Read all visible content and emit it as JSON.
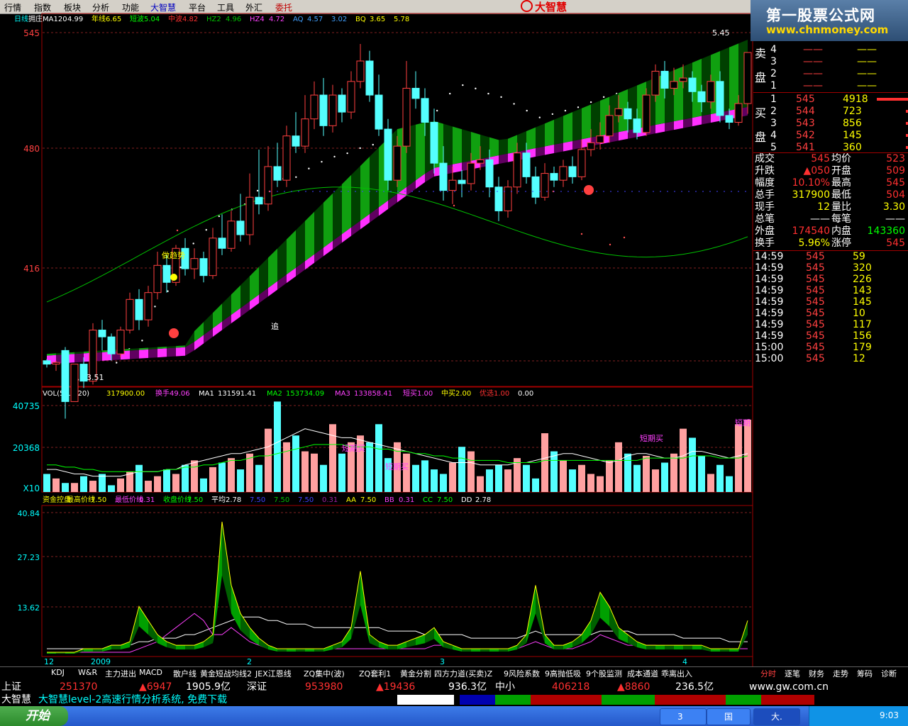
{
  "menu": [
    "行情",
    "指数",
    "板块",
    "分析",
    "功能",
    "大智慧",
    "平台",
    "工具",
    "外汇",
    "委托"
  ],
  "logo": "大智慧",
  "watermark": {
    "line1": "第一股票公式网",
    "line2": "www.chnmoney.com"
  },
  "main_legend": [
    {
      "t": "日线",
      "c": "#00ffff"
    },
    {
      "t": "拥庄MA120",
      "c": "#ffffff"
    },
    {
      "t": "4.99",
      "c": "#ffffff"
    },
    {
      "t": "年线",
      "c": "#ffff00"
    },
    {
      "t": "6.65",
      "c": "#ffff00"
    },
    {
      "t": "短波",
      "c": "#00ff00"
    },
    {
      "t": "5.04",
      "c": "#00ff00"
    },
    {
      "t": "中波",
      "c": "#ff3030"
    },
    {
      "t": "4.82",
      "c": "#ff3030"
    },
    {
      "t": "HZ2",
      "c": "#00c000"
    },
    {
      "t": "4.96",
      "c": "#00c000"
    },
    {
      "t": "HZ4",
      "c": "#ff40ff"
    },
    {
      "t": "4.72",
      "c": "#ff40ff"
    },
    {
      "t": "AQ",
      "c": "#40a0ff"
    },
    {
      "t": "4.57",
      "c": "#40a0ff"
    },
    {
      "t": "3.02",
      "c": "#40a0ff"
    },
    {
      "t": "BQ",
      "c": "#ffff00"
    },
    {
      "t": "3.65",
      "c": "#ffff00"
    },
    {
      "t": "5.78",
      "c": "#ffff00"
    }
  ],
  "y_axis_main": [
    "545",
    "480",
    "416"
  ],
  "price_annot": {
    "high": "5.45",
    "low": "3.51",
    "tag1": "做趋势",
    "tag2": "追"
  },
  "vol_legend": [
    {
      "t": "VOL(5,10,20)",
      "c": "#ffffff"
    },
    {
      "t": "317900.00",
      "c": "#ffff00"
    },
    {
      "t": "换手",
      "c": "#ff40ff"
    },
    {
      "t": "49.06",
      "c": "#ff40ff"
    },
    {
      "t": "MA1",
      "c": "#ffffff"
    },
    {
      "t": "131591.41",
      "c": "#ffffff"
    },
    {
      "t": "MA2",
      "c": "#00ff00"
    },
    {
      "t": "153734.09",
      "c": "#00ff00"
    },
    {
      "t": "MA3",
      "c": "#ff40ff"
    },
    {
      "t": "133858.41",
      "c": "#ff40ff"
    },
    {
      "t": "短买",
      "c": "#ff40ff"
    },
    {
      "t": "1.00",
      "c": "#ff40ff"
    },
    {
      "t": "中买",
      "c": "#ffff00"
    },
    {
      "t": "2.00",
      "c": "#ffff00"
    },
    {
      "t": "优选",
      "c": "#ff3030"
    },
    {
      "t": "1.00",
      "c": "#ff3030"
    },
    {
      "t": "0.00",
      "c": "#ffffff"
    }
  ],
  "y_axis_vol": [
    "40735",
    "20368",
    "X10"
  ],
  "vol_annot": [
    "短期买",
    "短期买",
    "短期买",
    "短期"
  ],
  "ctrl_legend": [
    {
      "t": "资金控盘",
      "c": "#ffff00"
    },
    {
      "t": "最高价线",
      "c": "#ffff00"
    },
    {
      "t": "7.50",
      "c": "#ffff00"
    },
    {
      "t": "最低价线",
      "c": "#ff40ff"
    },
    {
      "t": "0.31",
      "c": "#ff40ff"
    },
    {
      "t": "收盘价线",
      "c": "#00ff00"
    },
    {
      "t": "7.50",
      "c": "#00ff00"
    },
    {
      "t": "平均",
      "c": "#ffffff"
    },
    {
      "t": "2.78",
      "c": "#ffffff"
    },
    {
      "t": "7.50",
      "c": "#4040ff"
    },
    {
      "t": "7.50",
      "c": "#00c000"
    },
    {
      "t": "7.50",
      "c": "#4040ff"
    },
    {
      "t": "0.31",
      "c": "#a020a0"
    },
    {
      "t": "AA",
      "c": "#ffff00"
    },
    {
      "t": "7.50",
      "c": "#ffff00"
    },
    {
      "t": "BB",
      "c": "#ff40ff"
    },
    {
      "t": "0.31",
      "c": "#ff40ff"
    },
    {
      "t": "CC",
      "c": "#00ff00"
    },
    {
      "t": "7.50",
      "c": "#00ff00"
    },
    {
      "t": "DD",
      "c": "#ffffff"
    },
    {
      "t": "2.78",
      "c": "#ffffff"
    }
  ],
  "y_axis_ctrl": [
    "40.84",
    "27.23",
    "13.62"
  ],
  "date_labels": [
    "12",
    "2009",
    "2",
    "3",
    "4"
  ],
  "order_book": {
    "sell_label": [
      "卖",
      "盘"
    ],
    "buy_label": [
      "买",
      "盘"
    ],
    "sell": [
      {
        "n": "4",
        "p": "——",
        "v": "——"
      },
      {
        "n": "3",
        "p": "——",
        "v": "——"
      },
      {
        "n": "2",
        "p": "——",
        "v": "——"
      },
      {
        "n": "1",
        "p": "——",
        "v": "——"
      }
    ],
    "buy": [
      {
        "n": "1",
        "p": "545",
        "v": "4918"
      },
      {
        "n": "2",
        "p": "544",
        "v": "723"
      },
      {
        "n": "3",
        "p": "543",
        "v": "856"
      },
      {
        "n": "4",
        "p": "542",
        "v": "145"
      },
      {
        "n": "5",
        "p": "541",
        "v": "360"
      }
    ]
  },
  "quote": [
    {
      "l": "成交",
      "v": "545",
      "l2": "均价",
      "v2": "523",
      "vc": "#ff3030",
      "v2c": "#ff3030"
    },
    {
      "l": "升跌",
      "v": "▲050",
      "l2": "开盘",
      "v2": "509",
      "vc": "#ff3030",
      "v2c": "#ff3030"
    },
    {
      "l": "幅度",
      "v": "10.10%",
      "l2": "最高",
      "v2": "545",
      "vc": "#ff3030",
      "v2c": "#ff3030"
    },
    {
      "l": "总手",
      "v": "317900",
      "l2": "最低",
      "v2": "504",
      "vc": "#ffff00",
      "v2c": "#ff3030"
    },
    {
      "l": "现手",
      "v": "12",
      "l2": "量比",
      "v2": "3.30",
      "vc": "#ffff00",
      "v2c": "#ffff00"
    },
    {
      "l": "总笔",
      "v": "——",
      "l2": "每笔",
      "v2": "——",
      "vc": "#ffffff",
      "v2c": "#ffffff"
    },
    {
      "l": "外盘",
      "v": "174540",
      "l2": "内盘",
      "v2": "143360",
      "vc": "#ff3030",
      "v2c": "#00ff00"
    },
    {
      "l": "换手",
      "v": "5.96%",
      "l2": "涨停",
      "v2": "545",
      "vc": "#ffff00",
      "v2c": "#ff3030"
    }
  ],
  "ticks": [
    {
      "t": "14:59",
      "p": "545",
      "v": "59"
    },
    {
      "t": "14:59",
      "p": "545",
      "v": "320"
    },
    {
      "t": "14:59",
      "p": "545",
      "v": "226"
    },
    {
      "t": "14:59",
      "p": "545",
      "v": "143"
    },
    {
      "t": "14:59",
      "p": "545",
      "v": "145"
    },
    {
      "t": "14:59",
      "p": "545",
      "v": "10"
    },
    {
      "t": "14:59",
      "p": "545",
      "v": "117"
    },
    {
      "t": "14:59",
      "p": "545",
      "v": "156"
    },
    {
      "t": "15:00",
      "p": "545",
      "v": "179"
    },
    {
      "t": "15:00",
      "p": "545",
      "v": "12"
    }
  ],
  "bottom_tabs": [
    "KDJ",
    "W&R",
    "主力进出",
    "MACD",
    "散户线",
    "黄金短战均线2",
    "JEX江恩线",
    "ZQ集中(波)",
    "ZQ套利1",
    "黄金分割",
    "四方力道(买卖)Z",
    "9风险系数",
    "9高抛低吸",
    "9个股监测",
    "成本通道",
    "乖离出入"
  ],
  "right_tabs": [
    "分时",
    "逐笔",
    "财务",
    "走势",
    "筹码",
    "诊断"
  ],
  "index_bar": [
    {
      "t": "上证",
      "c": "#ffffff"
    },
    {
      "t": "251370",
      "c": "#ff3030"
    },
    {
      "t": "▲6947",
      "c": "#ff3030"
    },
    {
      "t": "1905.9亿",
      "c": "#ffffff"
    },
    {
      "t": "深证",
      "c": "#ffffff"
    },
    {
      "t": "953980",
      "c": "#ff3030"
    },
    {
      "t": "▲19436",
      "c": "#ff3030"
    },
    {
      "t": "936.3亿",
      "c": "#ffffff"
    },
    {
      "t": "中小",
      "c": "#ffffff"
    },
    {
      "t": "406218",
      "c": "#ff3030"
    },
    {
      "t": "▲8860",
      "c": "#ff3030"
    },
    {
      "t": "236.5亿",
      "c": "#ffffff"
    },
    {
      "t": "www.gw.com.cn",
      "c": "#ffffff"
    }
  ],
  "status_text": {
    "brand": "大智慧",
    "msg": "大智慧level-2高速行情分析系统, 免费下载"
  },
  "taskbar": {
    "start": "开始",
    "items": [
      "3",
      "国",
      "大."
    ],
    "clock": "9:03"
  },
  "chart_data": {
    "type": "candlestick",
    "price_scale": "x100 (price in cents)",
    "ylim": [
      351,
      560
    ],
    "candles": [
      [
        364,
        362,
        365,
        360
      ],
      [
        362,
        363,
        364,
        358
      ],
      [
        370,
        340,
        372,
        330
      ],
      [
        340,
        362,
        362,
        340
      ],
      [
        362,
        352,
        366,
        348
      ],
      [
        352,
        382,
        386,
        350
      ],
      [
        382,
        378,
        388,
        370
      ],
      [
        378,
        368,
        380,
        364
      ],
      [
        368,
        382,
        384,
        366
      ],
      [
        382,
        400,
        404,
        380
      ],
      [
        400,
        388,
        406,
        382
      ],
      [
        388,
        404,
        408,
        384
      ],
      [
        404,
        420,
        428,
        400
      ],
      [
        420,
        410,
        426,
        404
      ],
      [
        410,
        430,
        432,
        408
      ],
      [
        430,
        418,
        436,
        414
      ],
      [
        418,
        424,
        430,
        412
      ],
      [
        424,
        414,
        428,
        410
      ],
      [
        414,
        436,
        442,
        412
      ],
      [
        436,
        430,
        450,
        426
      ],
      [
        430,
        446,
        452,
        428
      ],
      [
        446,
        438,
        462,
        434
      ],
      [
        438,
        460,
        474,
        432
      ],
      [
        460,
        456,
        488,
        450
      ],
      [
        456,
        478,
        490,
        452
      ],
      [
        478,
        470,
        492,
        466
      ],
      [
        470,
        496,
        502,
        466
      ],
      [
        496,
        490,
        510,
        486
      ],
      [
        490,
        506,
        520,
        486
      ],
      [
        506,
        520,
        528,
        500
      ],
      [
        520,
        502,
        530,
        496
      ],
      [
        502,
        520,
        526,
        498
      ],
      [
        520,
        510,
        524,
        504
      ],
      [
        510,
        528,
        534,
        506
      ],
      [
        528,
        540,
        550,
        524
      ],
      [
        540,
        520,
        546,
        516
      ],
      [
        520,
        500,
        532,
        496
      ],
      [
        500,
        470,
        506,
        464
      ],
      [
        470,
        490,
        496,
        466
      ],
      [
        490,
        524,
        540,
        486
      ],
      [
        524,
        518,
        534,
        512
      ],
      [
        518,
        504,
        524,
        496
      ],
      [
        504,
        480,
        512,
        474
      ],
      [
        480,
        464,
        490,
        458
      ],
      [
        464,
        470,
        478,
        456
      ],
      [
        470,
        468,
        476,
        460
      ],
      [
        468,
        480,
        486,
        464
      ],
      [
        480,
        482,
        490,
        476
      ],
      [
        482,
        466,
        488,
        460
      ],
      [
        466,
        452,
        472,
        446
      ],
      [
        452,
        466,
        470,
        448
      ],
      [
        466,
        486,
        492,
        462
      ],
      [
        486,
        472,
        492,
        468
      ],
      [
        472,
        460,
        478,
        456
      ],
      [
        460,
        474,
        480,
        458
      ],
      [
        474,
        470,
        478,
        466
      ],
      [
        470,
        478,
        482,
        466
      ],
      [
        478,
        472,
        484,
        468
      ],
      [
        472,
        488,
        494,
        470
      ],
      [
        488,
        492,
        500,
        484
      ],
      [
        492,
        496,
        504,
        488
      ],
      [
        496,
        508,
        514,
        492
      ],
      [
        508,
        512,
        520,
        504
      ],
      [
        512,
        506,
        516,
        498
      ],
      [
        506,
        498,
        512,
        494
      ],
      [
        498,
        520,
        524,
        496
      ],
      [
        520,
        534,
        538,
        516
      ],
      [
        534,
        524,
        540,
        518
      ],
      [
        524,
        528,
        536,
        520
      ],
      [
        528,
        530,
        538,
        524
      ],
      [
        530,
        522,
        534,
        516
      ],
      [
        522,
        516,
        526,
        510
      ],
      [
        516,
        528,
        532,
        512
      ],
      [
        528,
        508,
        534,
        504
      ],
      [
        508,
        504,
        512,
        500
      ],
      [
        504,
        515,
        520,
        502
      ],
      [
        515,
        545,
        545,
        509
      ]
    ],
    "ma120": [
      352,
      363,
      366,
      362,
      370,
      375,
      395,
      404,
      418,
      432,
      440,
      448,
      452,
      455,
      463,
      469,
      470,
      471,
      476,
      480,
      483,
      485,
      488,
      490,
      495,
      498,
      500,
      505,
      510,
      520,
      525,
      523,
      520,
      518,
      514,
      510,
      506,
      508,
      510,
      512,
      515,
      518,
      520,
      522,
      524,
      525,
      526,
      527,
      528,
      529,
      530,
      531,
      532
    ],
    "volume": {
      "x10": true,
      "values": [
        8,
        6,
        4,
        4,
        7,
        5,
        8,
        3,
        6,
        9,
        12,
        5,
        7,
        10,
        8,
        12,
        14,
        6,
        11,
        13,
        15,
        10,
        17,
        12,
        28,
        40,
        22,
        25,
        18,
        17,
        12,
        30,
        17,
        22,
        25,
        22,
        30,
        15,
        22,
        17,
        12,
        14,
        10,
        8,
        13,
        20,
        18,
        7,
        10,
        12,
        10,
        15,
        12,
        6,
        26,
        18,
        14,
        10,
        12,
        8,
        7,
        14,
        22,
        17,
        12,
        16,
        10,
        13,
        17,
        28,
        24,
        16,
        8,
        12,
        7,
        30,
        32
      ],
      "ma1": [
        10,
        10,
        9,
        8,
        8,
        7,
        7,
        7,
        7,
        8,
        9,
        9,
        9,
        10,
        10,
        12,
        13,
        14,
        15,
        16,
        17,
        17,
        18,
        19,
        20,
        22,
        24,
        26,
        28,
        27,
        26,
        25,
        24,
        24,
        23,
        22,
        21,
        20,
        19,
        18,
        17,
        16,
        15,
        14,
        13,
        13,
        13,
        12,
        12,
        12,
        12,
        13,
        13,
        14,
        15,
        16,
        17,
        17,
        16,
        15,
        14,
        13,
        14,
        16,
        17,
        17,
        16,
        15,
        15,
        16,
        18,
        18,
        17,
        16,
        15,
        16,
        17
      ],
      "ma2": [
        12,
        12,
        11,
        11,
        10,
        10,
        9,
        9,
        9,
        9,
        9,
        9,
        9,
        10,
        10,
        11,
        11,
        12,
        12,
        13,
        14,
        14,
        15,
        16,
        16,
        17,
        18,
        19,
        20,
        21,
        21,
        21,
        21,
        20,
        20,
        20,
        19,
        19,
        18,
        18,
        17,
        17,
        16,
        16,
        15,
        15,
        14,
        14,
        14,
        14,
        13,
        13,
        13,
        13,
        14,
        14,
        14,
        14,
        14,
        14,
        14,
        14,
        14,
        14,
        14,
        15,
        15,
        15,
        15,
        15,
        16,
        16,
        16,
        15,
        15,
        15,
        16
      ]
    },
    "ctrl_series": {
      "aa": [
        1,
        1,
        1,
        1,
        2,
        2,
        2,
        3,
        3,
        4,
        14,
        10,
        6,
        4,
        3,
        3,
        3,
        4,
        6,
        38,
        20,
        12,
        8,
        5,
        3,
        2,
        2,
        2,
        2,
        2,
        2,
        3,
        4,
        8,
        24,
        6,
        4,
        3,
        3,
        4,
        5,
        6,
        8,
        4,
        3,
        2,
        2,
        2,
        2,
        2,
        2,
        3,
        6,
        20,
        6,
        3,
        3,
        4,
        6,
        10,
        18,
        14,
        8,
        6,
        4,
        3,
        3,
        3,
        3,
        3,
        3,
        3,
        2,
        2,
        2,
        2,
        10
      ],
      "avg": [
        2,
        2,
        2,
        2,
        2,
        2,
        2,
        3,
        3,
        3,
        4,
        4,
        5,
        5,
        5,
        6,
        6,
        7,
        8,
        9,
        10,
        11,
        11,
        11,
        10,
        10,
        9,
        9,
        9,
        8,
        8,
        8,
        8,
        8,
        8,
        8,
        8,
        7,
        7,
        7,
        7,
        6,
        6,
        6,
        6,
        6,
        5,
        5,
        5,
        5,
        5,
        5,
        6,
        7,
        6,
        6,
        6,
        6,
        6,
        6,
        7,
        7,
        7,
        7,
        6,
        6,
        6,
        6,
        6,
        5,
        5,
        5,
        5,
        5,
        4,
        4,
        4
      ],
      "bb": [
        1,
        1,
        1,
        1,
        1,
        1,
        1,
        1,
        1,
        1,
        2,
        3,
        4,
        6,
        8,
        10,
        12,
        10,
        6,
        6,
        8,
        6,
        4,
        3,
        2,
        2,
        2,
        2,
        2,
        2,
        2,
        2,
        2,
        2,
        2,
        2,
        2,
        2,
        2,
        2,
        2,
        2,
        3,
        3,
        2,
        2,
        2,
        2,
        2,
        2,
        2,
        2,
        3,
        4,
        3,
        2,
        2,
        2,
        3,
        4,
        6,
        5,
        4,
        3,
        3,
        3,
        3,
        2,
        2,
        2,
        2,
        2,
        2,
        2,
        2,
        2,
        2
      ]
    }
  }
}
